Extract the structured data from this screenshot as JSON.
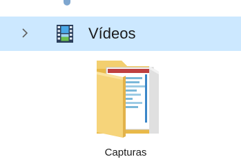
{
  "tree": {
    "row": {
      "label": "Vídeos",
      "icon": "video-folder-icon",
      "expanded": false,
      "selected": true
    }
  },
  "content": {
    "folder": {
      "label": "Capturas",
      "icon": "folder-icon"
    }
  },
  "colors": {
    "selection_background": "#cce8ff",
    "folder_yellow": "#f6d47a",
    "text": "#1a1a1a"
  }
}
